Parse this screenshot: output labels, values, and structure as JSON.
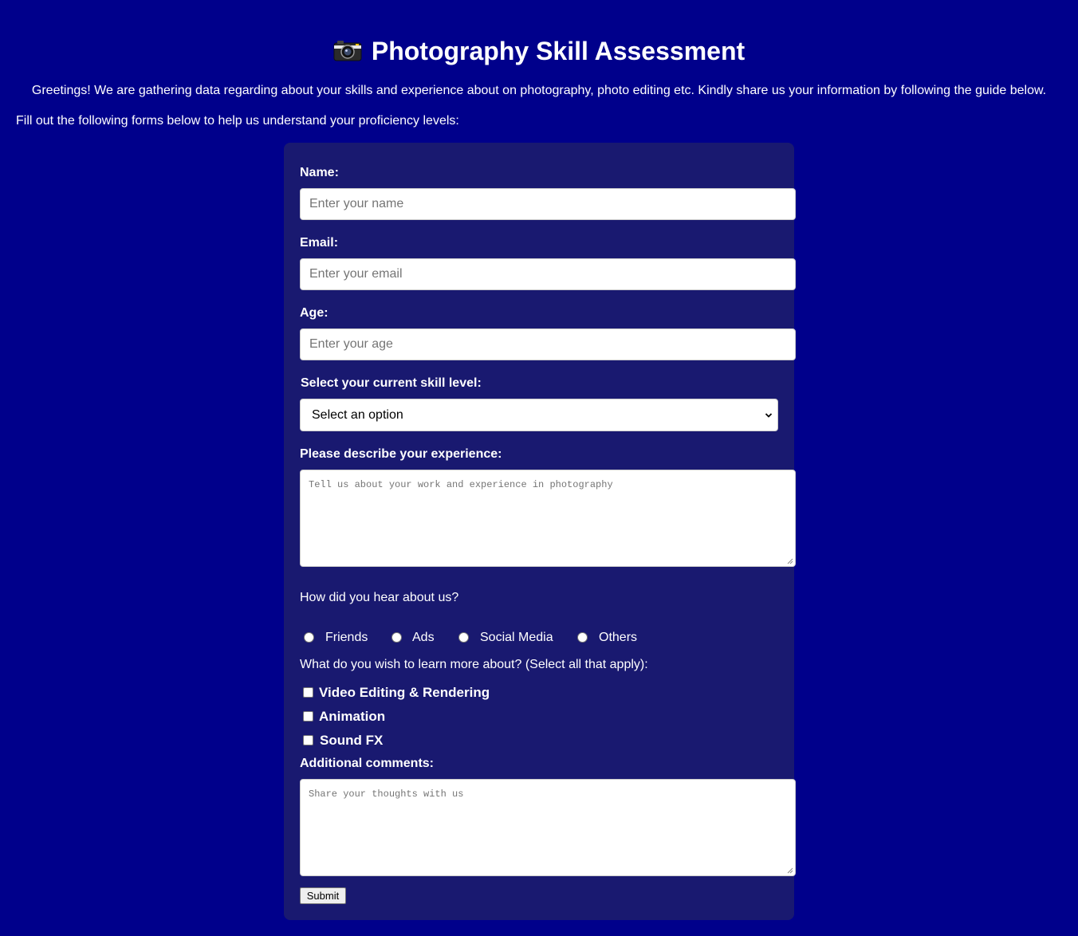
{
  "header": {
    "title": "Photography Skill Assessment",
    "icon": "camera-icon",
    "intro": "Greetings! We are gathering data regarding about your skills and experience about on photography, photo editing etc. Kindly share us your information by following the guide below.",
    "instructions": "Fill out the following forms below to help us understand your proficiency levels:"
  },
  "form": {
    "name": {
      "label": "Name:",
      "placeholder": "Enter your name"
    },
    "email": {
      "label": "Email:",
      "placeholder": "Enter your email"
    },
    "age": {
      "label": "Age:",
      "placeholder": "Enter your age"
    },
    "skill_level": {
      "label": "Select your current skill level:",
      "selected": "Select an option"
    },
    "experience": {
      "label": "Please describe your experience:",
      "placeholder": "Tell us about your work and experience in photography"
    },
    "heard_about": {
      "question": "How did you hear about us?",
      "options": [
        "Friends",
        "Ads",
        "Social Media",
        "Others"
      ]
    },
    "learn_more": {
      "question": "What do you wish to learn more about? (Select all that apply):",
      "options": [
        "Video Editing & Rendering",
        "Animation",
        "Sound FX"
      ]
    },
    "comments": {
      "label": "Additional comments:",
      "placeholder": "Share your thoughts with us"
    },
    "submit_label": "Submit"
  },
  "colors": {
    "page_background": "#00008b",
    "form_background": "#191970",
    "text": "#ffffff"
  }
}
